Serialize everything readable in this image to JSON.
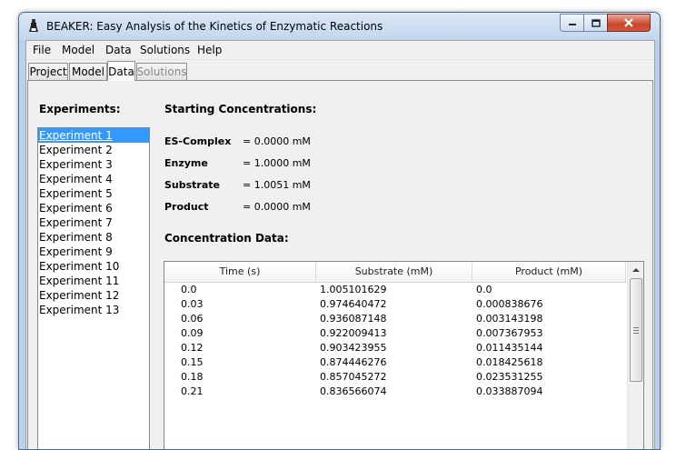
{
  "window": {
    "title": "BEAKER: Easy Analysis of the Kinetics of Enzymatic Reactions"
  },
  "menu": [
    "File",
    "Model",
    "Data",
    "Solutions",
    "Help"
  ],
  "tabs": [
    {
      "label": "Project",
      "state": "normal"
    },
    {
      "label": "Model",
      "state": "normal"
    },
    {
      "label": "Data",
      "state": "active"
    },
    {
      "label": "Solutions",
      "state": "disabled"
    }
  ],
  "experiments": {
    "heading": "Experiments:",
    "items": [
      "Experiment 1",
      "Experiment 2",
      "Experiment 3",
      "Experiment 4",
      "Experiment 5",
      "Experiment 6",
      "Experiment 7",
      "Experiment 8",
      "Experiment 9",
      "Experiment 10",
      "Experiment 11",
      "Experiment 12",
      "Experiment 13"
    ],
    "selected": "Experiment 1"
  },
  "starting": {
    "heading": "Starting Concentrations:",
    "rows": [
      {
        "label": "ES-Complex",
        "value": "= 0.0000 mM"
      },
      {
        "label": "Enzyme",
        "value": "= 1.0000 mM"
      },
      {
        "label": "Substrate",
        "value": "= 1.0051 mM"
      },
      {
        "label": "Product",
        "value": "= 0.0000 mM"
      }
    ]
  },
  "data_table": {
    "heading": "Concentration Data:",
    "columns": [
      "Time (s)",
      "Substrate (mM)",
      "Product (mM)"
    ],
    "rows": [
      [
        "0.0",
        "1.005101629",
        "0.0"
      ],
      [
        "0.03",
        "0.974640472",
        "0.000838676"
      ],
      [
        "0.06",
        "0.936087148",
        "0.003143198"
      ],
      [
        "0.09",
        "0.922009413",
        "0.007367953"
      ],
      [
        "0.12",
        "0.903423955",
        "0.011435144"
      ],
      [
        "0.15",
        "0.874446276",
        "0.018425618"
      ],
      [
        "0.18",
        "0.857045272",
        "0.023531255"
      ],
      [
        "0.21",
        "0.836566074",
        "0.033887094"
      ]
    ]
  },
  "colors": {
    "selection": "#3399ff",
    "close_button": "#c9462c"
  }
}
